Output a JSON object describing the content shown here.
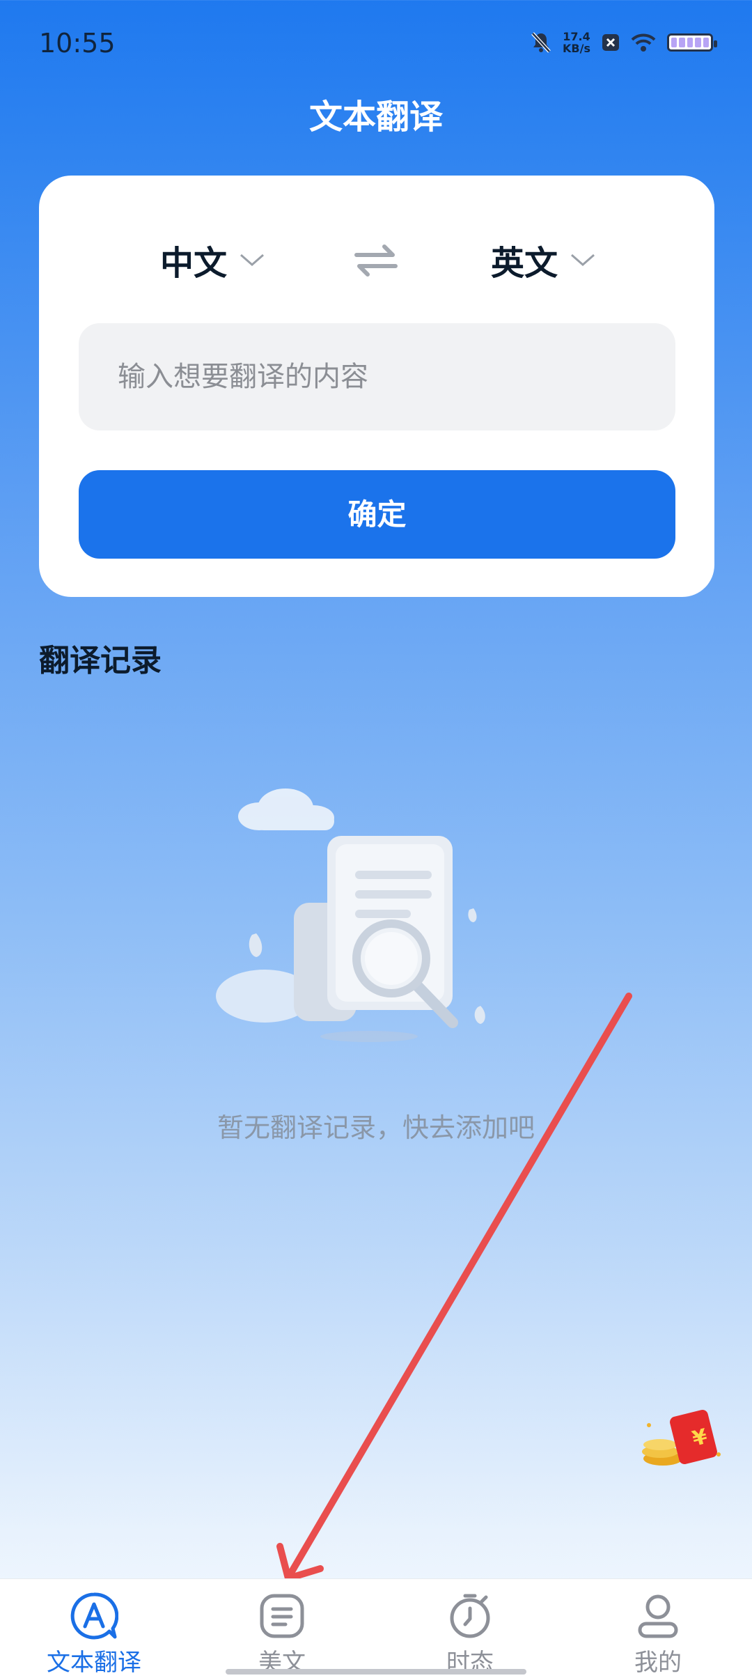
{
  "status_bar": {
    "time": "10:55",
    "net_speed_value": "17.4",
    "net_speed_unit": "KB/s"
  },
  "header": {
    "title": "文本翻译"
  },
  "translator": {
    "source_lang": "中文",
    "target_lang": "英文",
    "input_placeholder": "输入想要翻译的内容",
    "confirm_label": "确定"
  },
  "history": {
    "title": "翻译记录",
    "empty_text": "暂无翻译记录，快去添加吧"
  },
  "tabs": [
    {
      "label": "文本翻译",
      "icon": "translate-icon",
      "active": true
    },
    {
      "label": "美文",
      "icon": "article-icon",
      "active": false
    },
    {
      "label": "时态",
      "icon": "stopwatch-icon",
      "active": false
    },
    {
      "label": "我的",
      "icon": "profile-icon",
      "active": false
    }
  ],
  "colors": {
    "primary": "#1b73eb",
    "active_tab": "#1a6fe6",
    "annotation_arrow": "#e94e4e"
  }
}
